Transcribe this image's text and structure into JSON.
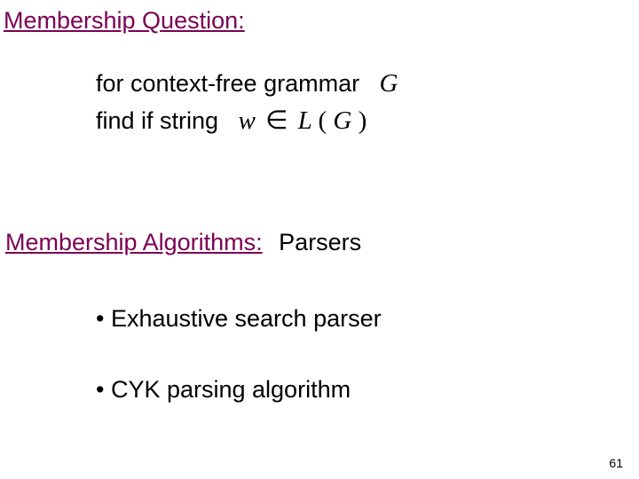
{
  "section1": {
    "heading": "Membership Question:",
    "line1_text": "for context-free grammar",
    "line1_math": "G",
    "line2_text": "find if string",
    "line2_math_w": "w",
    "line2_math_in": "∈",
    "line2_math_L": "L",
    "line2_math_open": "(",
    "line2_math_G": "G",
    "line2_math_close": ")"
  },
  "section2": {
    "heading": "Membership Algorithms:",
    "heading_suffix": "Parsers",
    "bullet1": "• Exhaustive search parser",
    "bullet2": "• CYK  parsing algorithm"
  },
  "page_number": "61"
}
